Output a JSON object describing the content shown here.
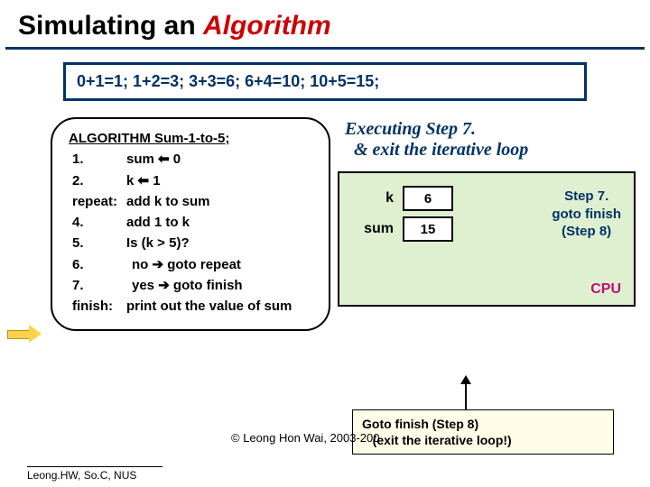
{
  "title": {
    "black": "Simulating an ",
    "red": "Algorithm"
  },
  "formula": "0+1=1;  1+2=3;  3+3=6;  6+4=10;  10+5=15;",
  "algo": {
    "header": "ALGORITHM Sum-1-to-5;",
    "rows": [
      {
        "lbl": "1.",
        "txt": "sum ⬅ 0"
      },
      {
        "lbl": "2.",
        "txt": "k ⬅ 1"
      },
      {
        "lbl": "repeat:",
        "txt": "add k to sum"
      },
      {
        "lbl": "4.",
        "txt": "add 1 to k"
      },
      {
        "lbl": "5.",
        "txt": "Is (k > 5)?"
      },
      {
        "lbl": "6.",
        "txt": " no ➔ goto repeat",
        "ind": true
      },
      {
        "lbl": "7.",
        "txt": " yes ➔ goto finish",
        "ind": true
      },
      {
        "lbl": "finish:",
        "txt": "print out the value of sum"
      }
    ]
  },
  "exec": {
    "line1": "Executing Step 7.",
    "line2": "  & exit the iterative loop"
  },
  "cpu": {
    "vars": [
      {
        "label": "k",
        "value": "6"
      },
      {
        "label": "sum",
        "value": "15"
      }
    ],
    "step_note_l1": "Step 7.",
    "step_note_l2": "goto finish",
    "step_note_l3": "(Step 8)",
    "label": "CPU"
  },
  "goto": {
    "l1": "Goto finish (Step 8)",
    "l2": "   (exit the iterative loop!)"
  },
  "copyright": "© Leong Hon Wai, 2003-200",
  "footer": "Leong.HW, So.C, NUS"
}
